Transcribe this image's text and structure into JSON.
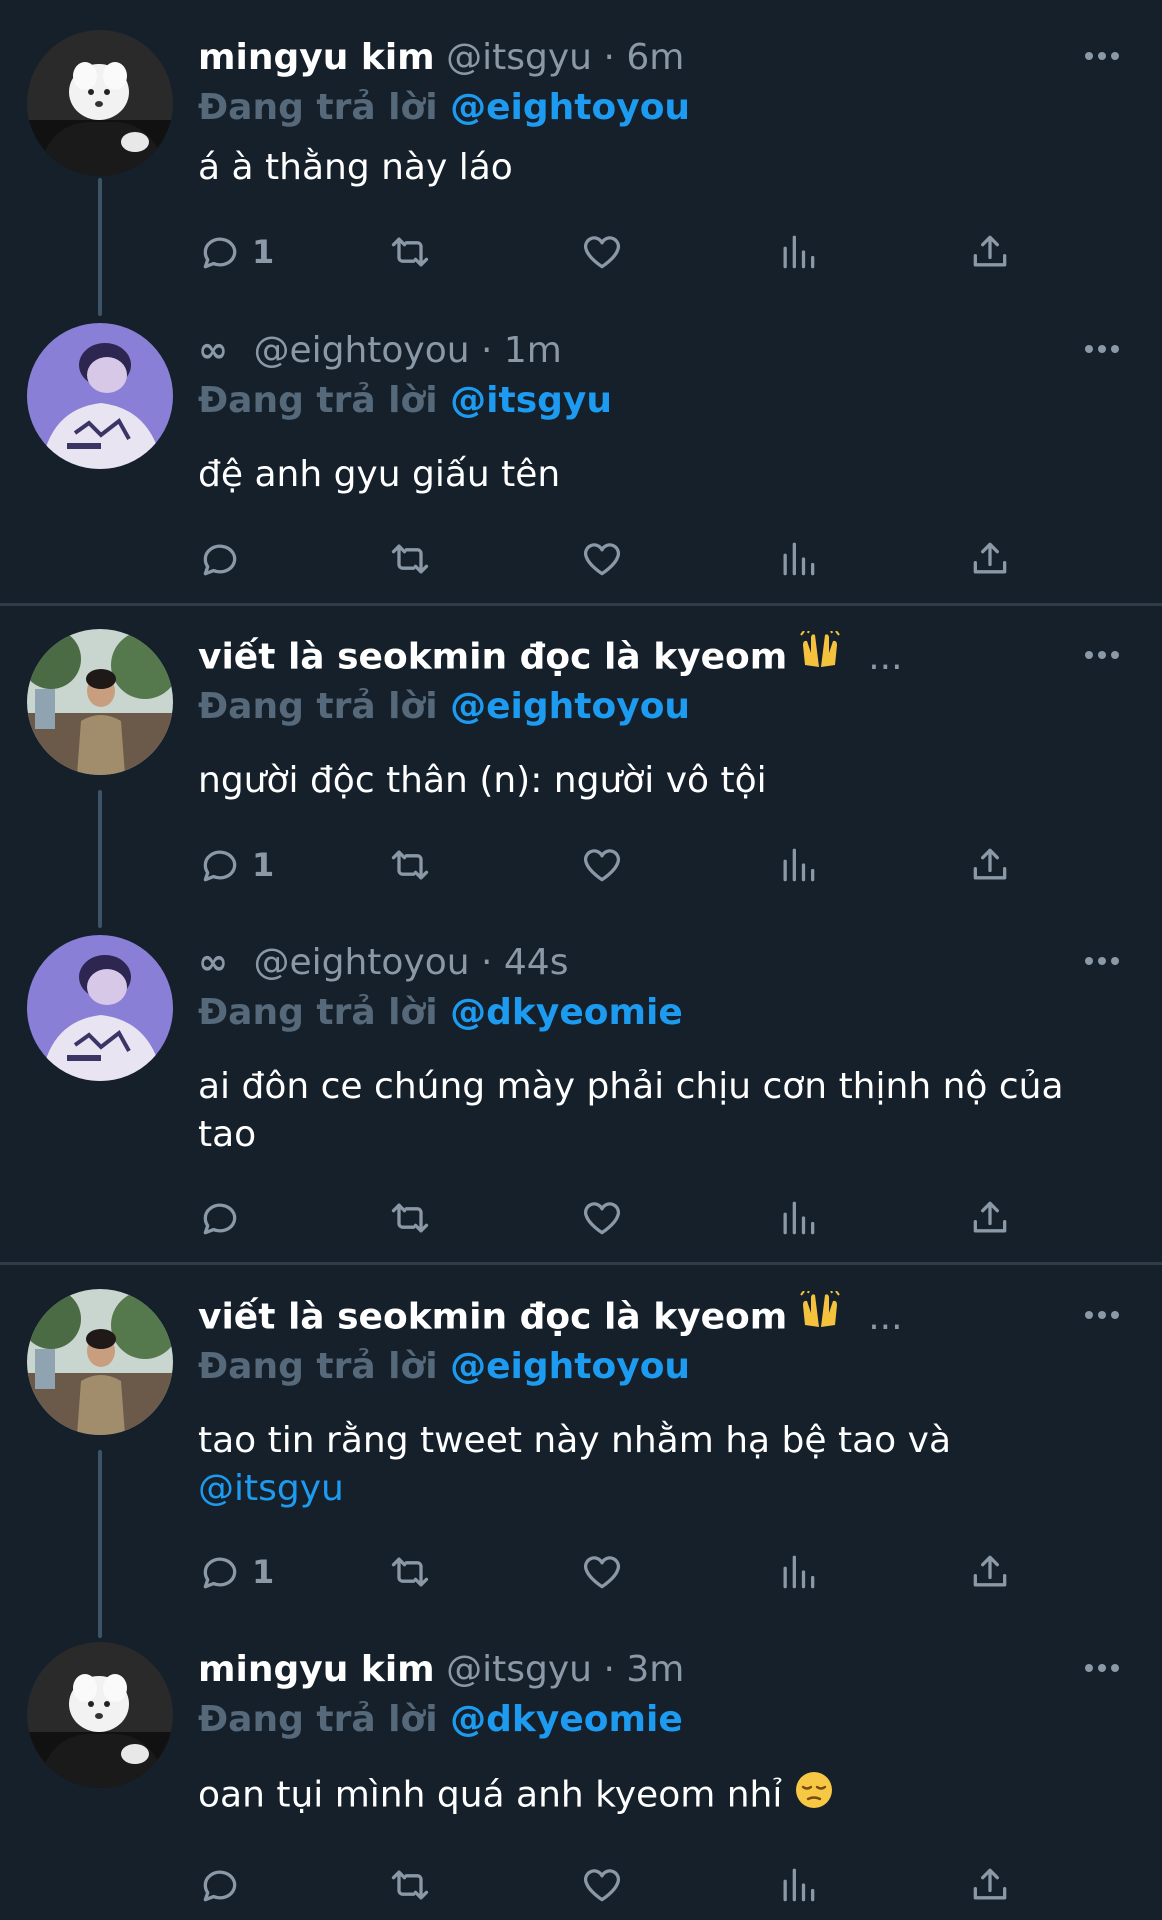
{
  "tweets": [
    {
      "name": "mingyu kim",
      "handle": "@itsgyu",
      "time": "· 6m",
      "replying_prefix": "Đang trả lời",
      "replying_to": "@eightoyou",
      "text": "á à thằng này láo",
      "reply_count": "1"
    },
    {
      "name_icon": "∞",
      "handle": "@eightoyou",
      "time": "· 1m",
      "replying_prefix": "Đang trả lời",
      "replying_to": "@itsgyu",
      "text": "đệ anh gyu giấu tên",
      "reply_count": ""
    },
    {
      "name": "viết là seokmin đọc là kyeom",
      "name_emoji": "raised-hands-emoji",
      "truncated": "...",
      "replying_prefix": "Đang trả lời",
      "replying_to": "@eightoyou",
      "text": "người độc thân (n): người vô tội",
      "reply_count": "1"
    },
    {
      "name_icon": "∞",
      "handle": "@eightoyou",
      "time": "· 44s",
      "replying_prefix": "Đang trả lời",
      "replying_to": "@dkyeomie",
      "text_line1": "ai đôn ce chúng mày phải chịu cơn thịnh nộ của",
      "text_line2": "tao",
      "reply_count": ""
    },
    {
      "name": "viết là seokmin đọc là kyeom",
      "name_emoji": "raised-hands-emoji",
      "truncated": "...",
      "replying_prefix": "Đang trả lời",
      "replying_to": "@eightoyou",
      "text": "tao tin rằng tweet này nhằm hạ bệ tao và",
      "text_mention": "@itsgyu",
      "reply_count": "1"
    },
    {
      "name": "mingyu kim",
      "handle": "@itsgyu",
      "time": "· 3m",
      "replying_prefix": "Đang trả lời",
      "replying_to": "@dkyeomie",
      "text": "oan tụi mình quá anh kyeom nhỉ",
      "text_emoji": "pensive-face-emoji",
      "reply_count": ""
    }
  ],
  "colors": {
    "background": "#15202b",
    "text": "#ffffff",
    "secondary": "#8b98a5",
    "replying_prefix": "#56697a",
    "mention": "#1d9bf0",
    "thread_line": "#3d5466",
    "divider": "#2f3c48"
  },
  "icons": {
    "more": "more-dots-icon",
    "reply": "reply-bubble-icon",
    "retweet": "retweet-icon",
    "like": "heart-icon",
    "views": "views-bars-icon",
    "share": "share-upload-icon"
  }
}
